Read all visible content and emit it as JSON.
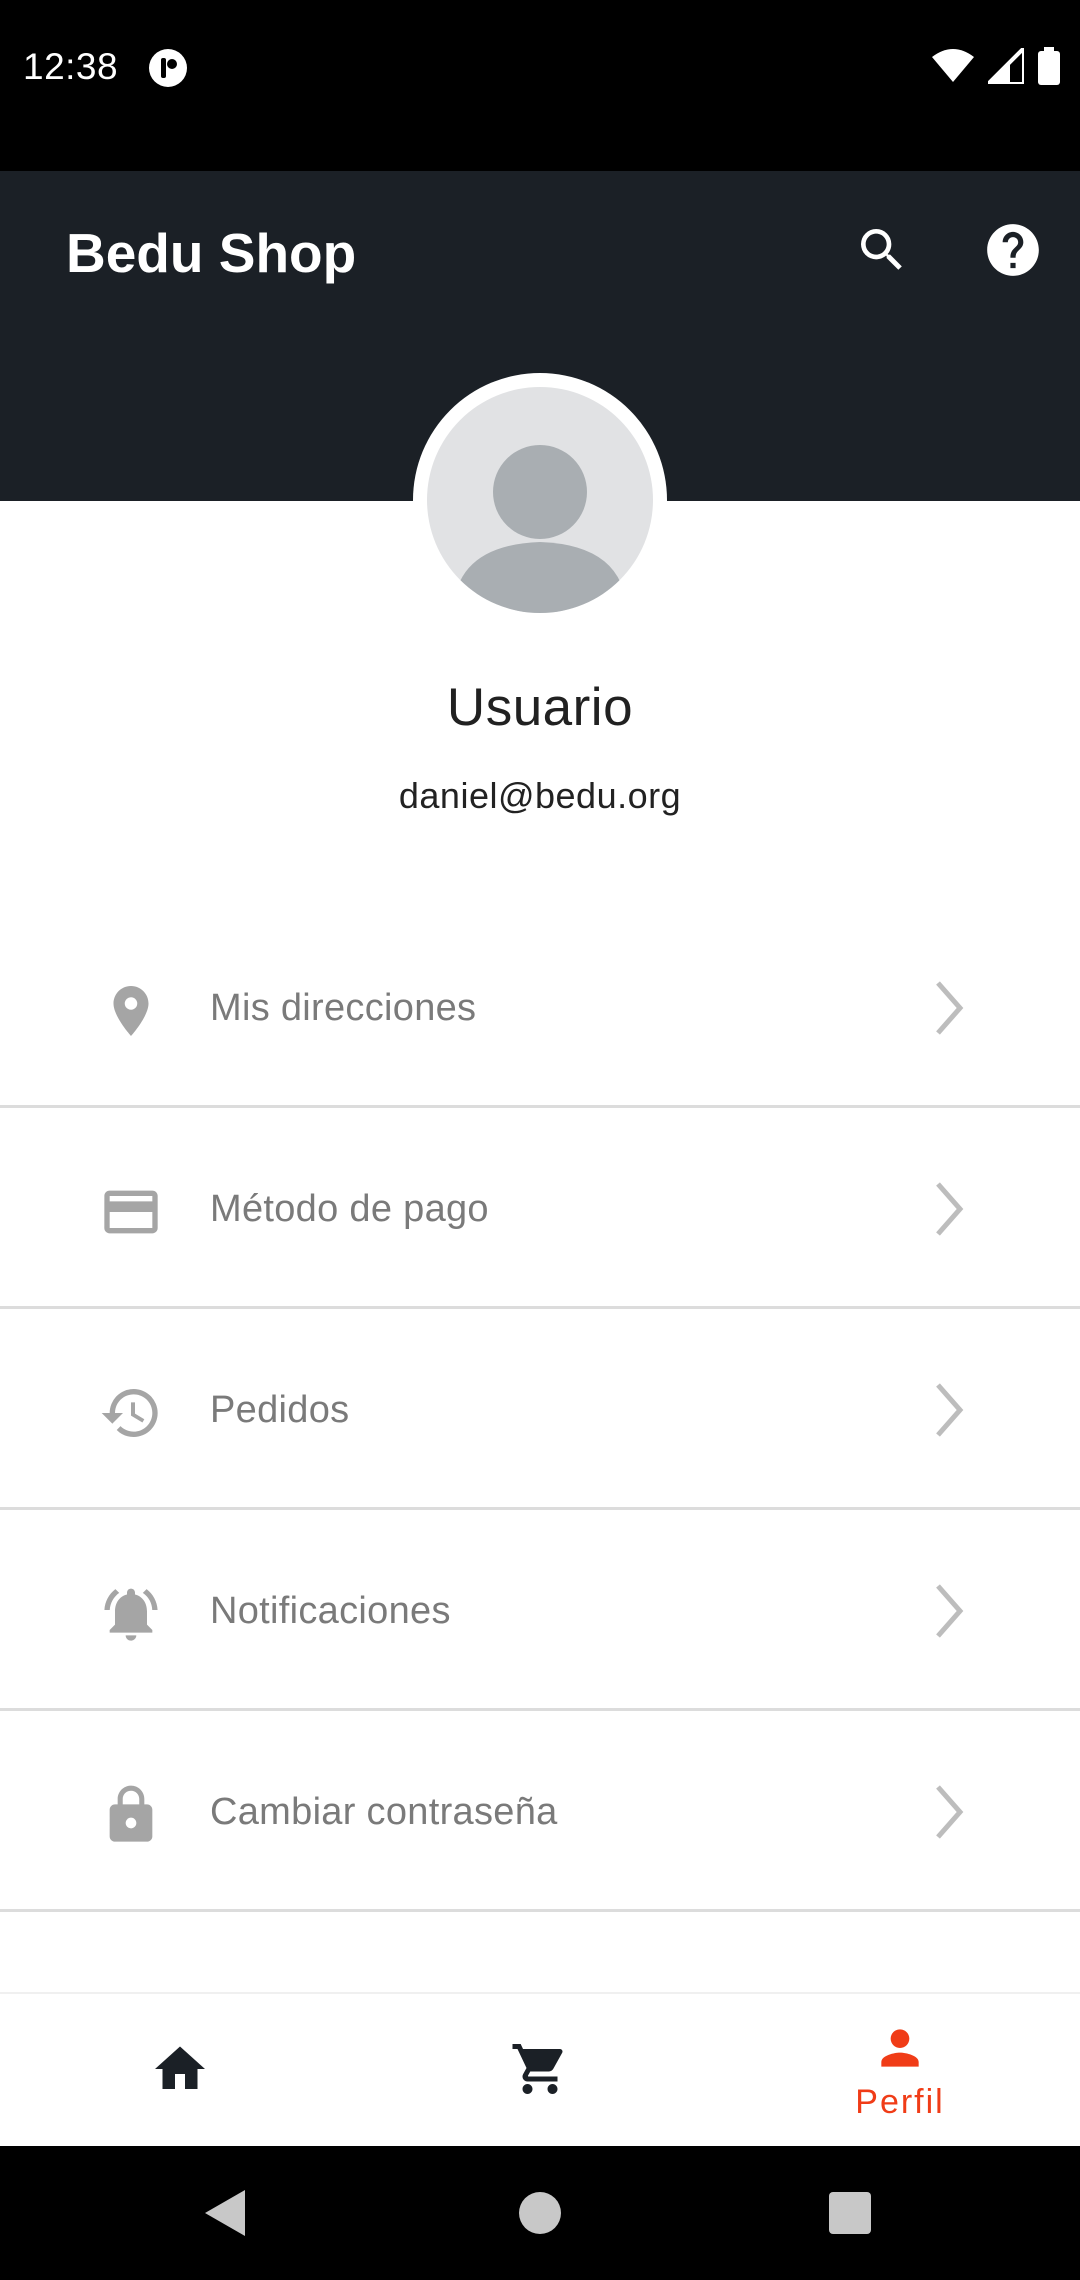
{
  "status_bar": {
    "time": "12:38",
    "icons": [
      "app-notification-icon",
      "wifi-icon",
      "signal-icon",
      "battery-icon"
    ]
  },
  "app_bar": {
    "title": "Bedu Shop",
    "actions": [
      "search-icon",
      "help-icon"
    ]
  },
  "profile": {
    "name": "Usuario",
    "email": "daniel@bedu.org"
  },
  "menu": {
    "items": [
      {
        "label": "Mis direcciones",
        "icon": "location-pin-icon"
      },
      {
        "label": "Método de pago",
        "icon": "credit-card-icon"
      },
      {
        "label": "Pedidos",
        "icon": "history-icon"
      },
      {
        "label": "Notificaciones",
        "icon": "bell-icon"
      },
      {
        "label": "Cambiar contraseña",
        "icon": "lock-icon"
      }
    ]
  },
  "bottom_nav": {
    "items": [
      {
        "icon": "home-icon",
        "label": ""
      },
      {
        "icon": "cart-icon",
        "label": ""
      },
      {
        "icon": "person-icon",
        "label": "Perfil",
        "active": true
      }
    ]
  },
  "colors": {
    "app_bar": "#1b2026",
    "accent": "#f03c17",
    "menu_text": "#7a7a7a",
    "icon_gray": "#a5a5a5"
  }
}
